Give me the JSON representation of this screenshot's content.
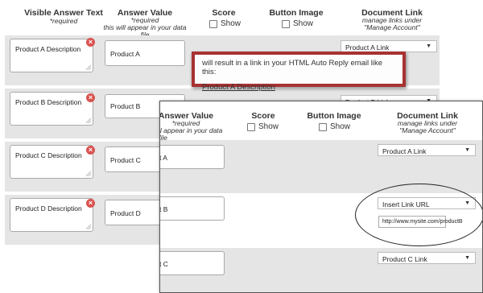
{
  "header": {
    "visible_text_title": "Visible Answer Text",
    "visible_text_sub": "*required",
    "answer_value_title": "Answer Value",
    "answer_value_sub1": "*required",
    "answer_value_sub2": "this will appear in your data file",
    "score_title": "Score",
    "score_show": "Show",
    "button_image_title": "Button Image",
    "button_image_show": "Show",
    "doc_link_title": "Document Link",
    "doc_link_sub1": "manage links under",
    "doc_link_sub2": "\"Manage Account\""
  },
  "rows": [
    {
      "visible_text": "Product A Description",
      "answer_value": "Product A",
      "doc_link": "Product A Link"
    },
    {
      "visible_text": "Product B Description",
      "answer_value": "Product B",
      "doc_link": "Product B Link"
    },
    {
      "visible_text": "Product C Description",
      "answer_value": "Product C",
      "doc_link": ""
    },
    {
      "visible_text": "Product D Description",
      "answer_value": "Product D",
      "doc_link": ""
    }
  ],
  "callout": {
    "text": "will result in a link in your HTML Auto Reply email like this:",
    "link": "Product A Description"
  },
  "front": {
    "answer_value_title": "Answer Value",
    "answer_value_sub1": "*required",
    "answer_value_sub2": "ll appear in your data file",
    "score_title": "Score",
    "score_show": "Show",
    "button_image_title": "Button Image",
    "button_image_show": "Show",
    "doc_link_title": "Document Link",
    "doc_link_sub1": "manage links under",
    "doc_link_sub2": "\"Manage Account\"",
    "rows": [
      {
        "answer_value": "t A",
        "doc_link": "Product A Link"
      },
      {
        "answer_value": "t B",
        "doc_link": "Insert Link URL",
        "url": "http://www.mysite.com/productB"
      },
      {
        "answer_value": "t C",
        "doc_link": "Product C Link"
      }
    ]
  },
  "colors": {
    "row_bg": "#e5e5e5",
    "remove_red": "#d9534f",
    "callout_border": "#a83232"
  }
}
